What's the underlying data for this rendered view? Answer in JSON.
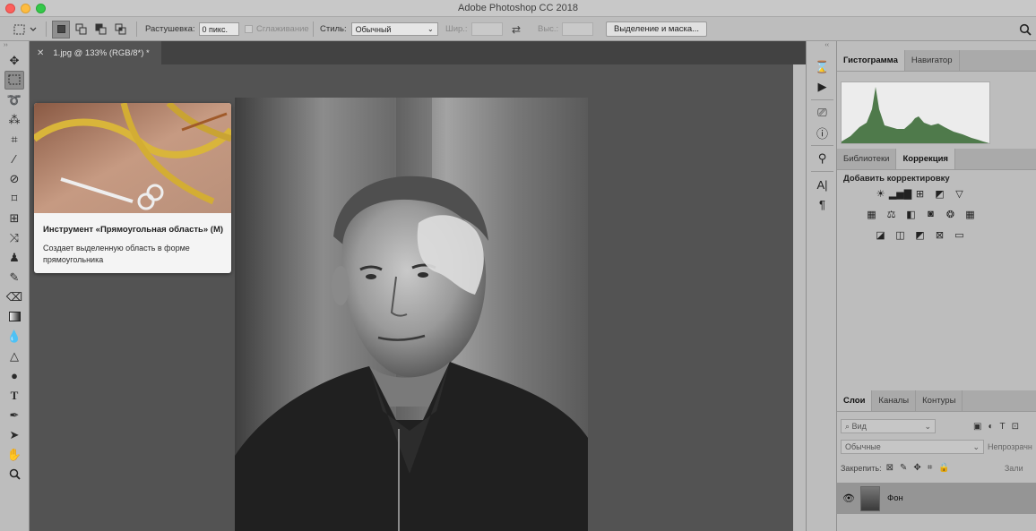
{
  "window": {
    "title": "Adobe Photoshop CC 2018"
  },
  "options_bar": {
    "feather_label": "Растушевка:",
    "feather_value": "0 пикс.",
    "antialias_label": "Сглаживание",
    "style_label": "Стиль:",
    "style_value": "Обычный",
    "width_label": "Шир.:",
    "height_label": "Выс.:",
    "select_mask_button": "Выделение и маска..."
  },
  "document": {
    "tab_title": "1.jpg @ 133% (RGB/8*) *"
  },
  "tooltip": {
    "title": "Инструмент «Прямоугольная область» (M)",
    "description": "Создает выделенную область в форме прямоугольника"
  },
  "panels": {
    "top_tabs": [
      "Гистограмма",
      "Навигатор"
    ],
    "mid_tabs": [
      "Библиотеки",
      "Коррекция"
    ],
    "adjustments_title": "Добавить корректировку",
    "layer_tabs": [
      "Слои",
      "Каналы",
      "Контуры"
    ],
    "layer_filter": "Вид",
    "blend_mode": "Обычные",
    "opacity_label": "Непрозрачн",
    "lock_label": "Закрепить:",
    "fill_label": "Зали",
    "layers": [
      {
        "name": "Фон"
      }
    ]
  },
  "icons": {
    "search": "search-icon",
    "visibility": "eye-icon"
  },
  "colors": {
    "ui_gray": "#bdbdbd",
    "canvas_bg": "#535353",
    "histogram_fill": "#4f7a4b"
  }
}
